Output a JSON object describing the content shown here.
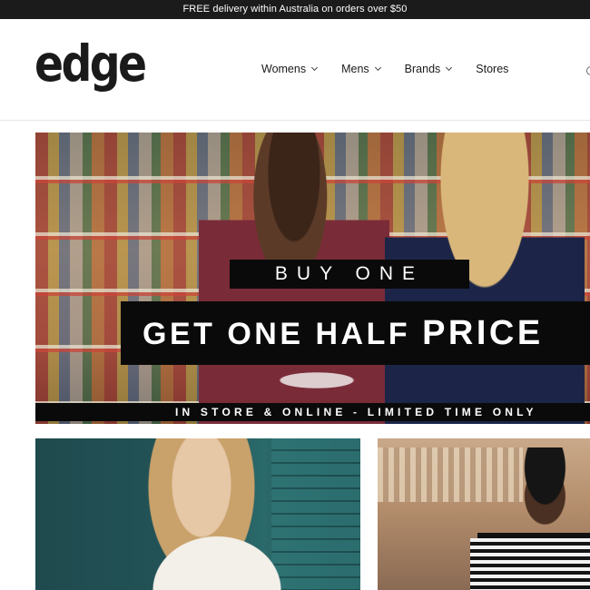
{
  "announcement": {
    "text": "FREE delivery within Australia on orders over $50"
  },
  "header": {
    "logo": "edge",
    "nav": [
      {
        "label": "Womens",
        "has_dropdown": true
      },
      {
        "label": "Mens",
        "has_dropdown": true
      },
      {
        "label": "Brands",
        "has_dropdown": true
      },
      {
        "label": "Stores",
        "has_dropdown": false
      }
    ]
  },
  "hero": {
    "line1": "BUY ONE",
    "line2_a": "GET ONE HALF ",
    "line2_b": "PRICE",
    "line3": "IN STORE & ONLINE - LIMITED TIME ONLY"
  },
  "colors": {
    "announcement_bg": "#1b1b1b",
    "banner_bg": "#0a0a0a",
    "text": "#1a1a1a"
  },
  "icons": [
    "chevron-down-icon"
  ]
}
